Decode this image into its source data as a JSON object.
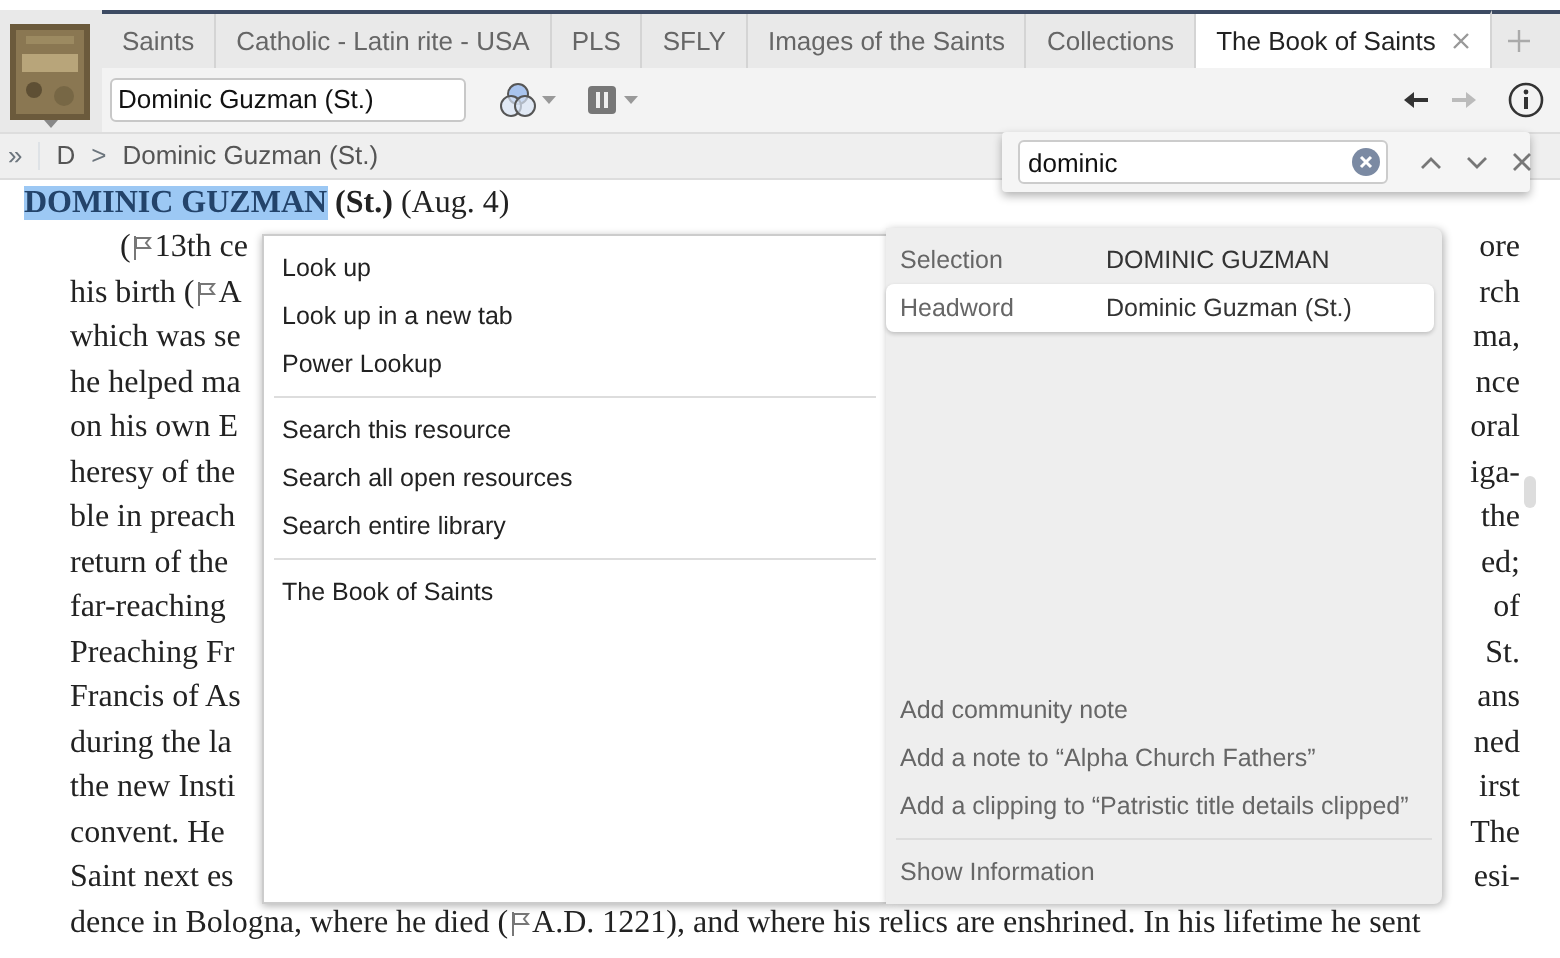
{
  "tabs": [
    {
      "label": "Saints",
      "selected": false
    },
    {
      "label": "Catholic - Latin rite - USA",
      "selected": false
    },
    {
      "label": "PLS",
      "selected": false
    },
    {
      "label": "SFLY",
      "selected": false
    },
    {
      "label": "Images of the Saints",
      "selected": false
    },
    {
      "label": "Collections",
      "selected": false
    },
    {
      "label": "The Book of Saints",
      "selected": true
    }
  ],
  "reference_field": {
    "value": "Dominic Guzman (St.)"
  },
  "navigation": {
    "back_disabled": false,
    "forward_disabled": true
  },
  "breadcrumb": {
    "expand": "»",
    "separator": ">",
    "items": [
      "D",
      "Dominic Guzman (St.)"
    ]
  },
  "find": {
    "value": "dominic"
  },
  "article": {
    "heading": {
      "name": "DOMINIC GUZMAN",
      "name_selected": true,
      "title": "(St.)",
      "date": "(Aug. 4)"
    },
    "lines": [
      {
        "left": [
          "(",
          "13th ce"
        ],
        "right": "ore",
        "indent": true
      },
      {
        "left": [
          "his birth (",
          "A"
        ],
        "right": "rch",
        "indent": false
      },
      {
        "left": [
          "which was se"
        ],
        "right": "ma,",
        "indent": false
      },
      {
        "left": [
          "he helped ma"
        ],
        "right": "nce",
        "indent": false
      },
      {
        "left": [
          "on his own E"
        ],
        "right": "oral",
        "indent": false
      },
      {
        "left": [
          "heresy of the"
        ],
        "right": "iga-",
        "indent": false
      },
      {
        "left": [
          "ble in preach"
        ],
        "right": "the",
        "indent": false
      },
      {
        "left": [
          "return of the"
        ],
        "right": "ed;",
        "indent": false
      },
      {
        "left": [
          "far-reaching"
        ],
        "right": "of",
        "indent": false
      },
      {
        "left": [
          "Preaching Fr"
        ],
        "right": "St.",
        "indent": false
      },
      {
        "left": [
          "Francis of As"
        ],
        "right": "ans",
        "indent": false
      },
      {
        "left": [
          "during the la"
        ],
        "right": "ned",
        "indent": false
      },
      {
        "left": [
          "the new Insti"
        ],
        "right": "irst",
        "indent": false
      },
      {
        "left": [
          "convent. He"
        ],
        "right": "The",
        "indent": false
      },
      {
        "left": [
          "Saint next es"
        ],
        "right": "esi-",
        "indent": false
      },
      {
        "left": [
          "dence in Bologna, where he died (",
          "A.D. 1221), and where his relics are enshrined. In his lifetime he sent"
        ],
        "indent": false
      }
    ]
  },
  "context_menu": {
    "groups": [
      [
        "Look up",
        "Look up in a new tab",
        "Power Lookup"
      ],
      [
        "Search this resource",
        "Search all open resources",
        "Search entire library"
      ],
      [
        "The Book of Saints"
      ]
    ]
  },
  "info_panel": {
    "fields": [
      {
        "label": "Selection",
        "value": "DOMINIC GUZMAN",
        "selected": false
      },
      {
        "label": "Headword",
        "value": "Dominic Guzman (St.)",
        "selected": true
      }
    ],
    "actions": [
      "Add community note",
      "Add a note to “Alpha Church Fathers”",
      "Add a clipping to “Patristic title details clipped”"
    ],
    "footer": "Show Information"
  }
}
